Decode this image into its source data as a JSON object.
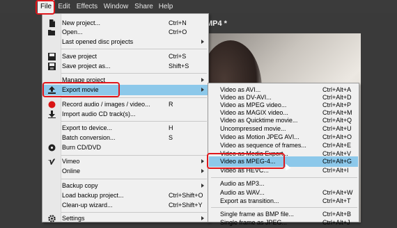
{
  "menubar": {
    "items": [
      {
        "label": "File"
      },
      {
        "label": "Edit"
      },
      {
        "label": "Effects"
      },
      {
        "label": "Window"
      },
      {
        "label": "Share"
      },
      {
        "label": "Help"
      }
    ]
  },
  "document": {
    "title": "MP4 *"
  },
  "file_menu": {
    "items": [
      {
        "label": "New project...",
        "shortcut": "Ctrl+N",
        "icon": "new-file-icon"
      },
      {
        "label": "Open...",
        "shortcut": "Ctrl+O",
        "icon": "open-folder-icon"
      },
      {
        "label": "Last opened disc projects",
        "shortcut": ""
      },
      {
        "label": "Save project",
        "shortcut": "Ctrl+S",
        "icon": "save-icon"
      },
      {
        "label": "Save project as...",
        "shortcut": "Shift+S",
        "icon": "save-as-icon"
      },
      {
        "label": "Manage project",
        "shortcut": ""
      },
      {
        "label": "Export movie",
        "shortcut": "",
        "icon": "export-icon"
      },
      {
        "label": "Record audio / images / video...",
        "shortcut": "R",
        "icon": "record-icon"
      },
      {
        "label": "Import audio CD track(s)...",
        "shortcut": "",
        "icon": "import-icon"
      },
      {
        "label": "Export to device...",
        "shortcut": "H"
      },
      {
        "label": "Batch conversion...",
        "shortcut": "S"
      },
      {
        "label": "Burn CD/DVD",
        "shortcut": "",
        "icon": "disc-icon"
      },
      {
        "label": "Vimeo",
        "shortcut": "",
        "icon": "vimeo-icon"
      },
      {
        "label": "Online",
        "shortcut": ""
      },
      {
        "label": "Backup copy",
        "shortcut": ""
      },
      {
        "label": "Load backup project...",
        "shortcut": "Ctrl+Shift+O"
      },
      {
        "label": "Clean-up wizard...",
        "shortcut": "Ctrl+Shift+Y"
      },
      {
        "label": "Settings",
        "shortcut": "",
        "icon": "settings-icon"
      }
    ]
  },
  "export_submenu": {
    "items": [
      {
        "label": "Video as AVI...",
        "shortcut": "Ctrl+Alt+A"
      },
      {
        "label": "Video as DV-AVI...",
        "shortcut": "Ctrl+Alt+D"
      },
      {
        "label": "Video as MPEG video...",
        "shortcut": "Ctrl+Alt+P"
      },
      {
        "label": "Video as MAGIX video...",
        "shortcut": "Ctrl+Alt+M"
      },
      {
        "label": "Video as Quicktime movie...",
        "shortcut": "Ctrl+Alt+Q"
      },
      {
        "label": "Uncompressed movie...",
        "shortcut": "Ctrl+Alt+U"
      },
      {
        "label": "Video as Motion JPEG AVI...",
        "shortcut": "Ctrl+Alt+O"
      },
      {
        "label": "Video as sequence of frames...",
        "shortcut": "Ctrl+Alt+E"
      },
      {
        "label": "Video as Media Export...",
        "shortcut": "Ctrl+Alt+V"
      },
      {
        "label": "Video as MPEG-4...",
        "shortcut": "Ctrl+Alt+G"
      },
      {
        "label": "Video as HEVC...",
        "shortcut": "Ctrl+Alt+I"
      },
      {
        "label": "Audio as MP3...",
        "shortcut": ""
      },
      {
        "label": "Audio as WAV...",
        "shortcut": "Ctrl+Alt+W"
      },
      {
        "label": "Export as transition...",
        "shortcut": "Ctrl+Alt+T"
      },
      {
        "label": "Single frame as BMP file...",
        "shortcut": "Ctrl+Alt+B"
      },
      {
        "label": "Single frame as JPEG...",
        "shortcut": "Ctrl+Alt+J"
      }
    ]
  },
  "colors": {
    "highlight": "#8cc8ea",
    "annotation_red": "#e0171c",
    "menubar": "#3b3b3b",
    "menu_bg": "#f0f0f0"
  }
}
